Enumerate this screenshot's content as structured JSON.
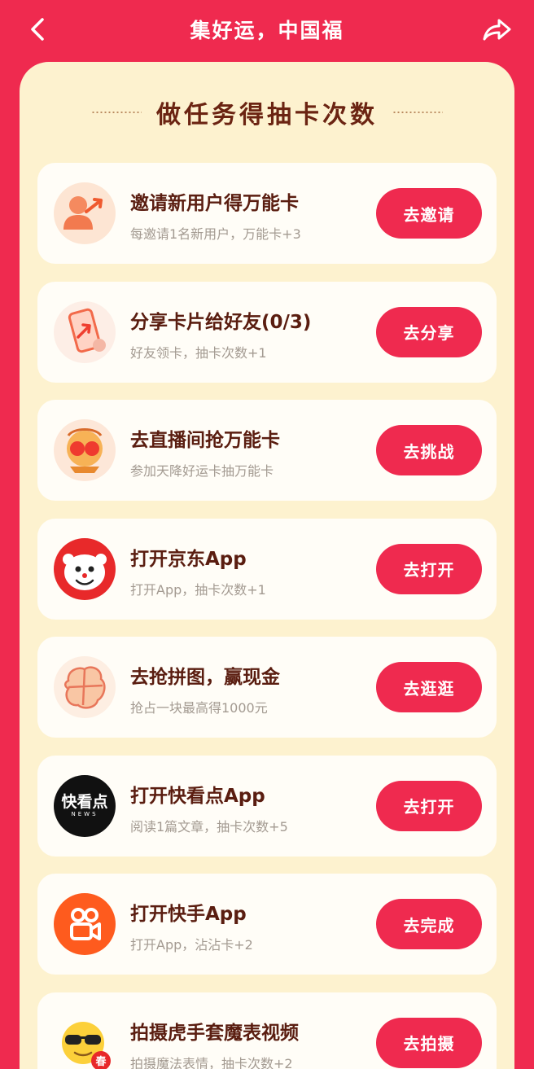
{
  "header": {
    "title": "集好运，中国福"
  },
  "section": {
    "title": "做任务得抽卡次数"
  },
  "tasks": [
    {
      "icon": "invite-user-icon",
      "title": "邀请新用户得万能卡",
      "desc": "每邀请1名新用户，万能卡+3",
      "button": "去邀请"
    },
    {
      "icon": "share-phone-icon",
      "title": "分享卡片给好友(0/3)",
      "desc": "好友领卡，抽卡次数+1",
      "button": "去分享"
    },
    {
      "icon": "live-stream-icon",
      "title": "去直播间抢万能卡",
      "desc": "参加天降好运卡抽万能卡",
      "button": "去挑战"
    },
    {
      "icon": "jd-app-icon",
      "title": "打开京东App",
      "desc": "打开App，抽卡次数+1",
      "button": "去打开"
    },
    {
      "icon": "puzzle-map-icon",
      "title": "去抢拼图，赢现金",
      "desc": "抢占一块最高得1000元",
      "button": "去逛逛"
    },
    {
      "icon": "kuaikandian-app-icon",
      "title": "打开快看点App",
      "desc": "阅读1篇文章，抽卡次数+5",
      "button": "去打开",
      "logo_text": "快看点",
      "logo_sub": "NEWS"
    },
    {
      "icon": "kuaishou-app-icon",
      "title": "打开快手App",
      "desc": "打开App，沾沾卡+2",
      "button": "去完成"
    },
    {
      "icon": "sunglasses-emoji-icon",
      "title": "拍摄虎手套魔表视频",
      "desc": "拍摄魔法表情，抽卡次数+2",
      "button": "去拍摄",
      "badge_text": "春"
    }
  ],
  "colors": {
    "brand_red": "#ef2a4f",
    "panel_bg": "#fdf2cf",
    "title_brown": "#5a1d10"
  }
}
